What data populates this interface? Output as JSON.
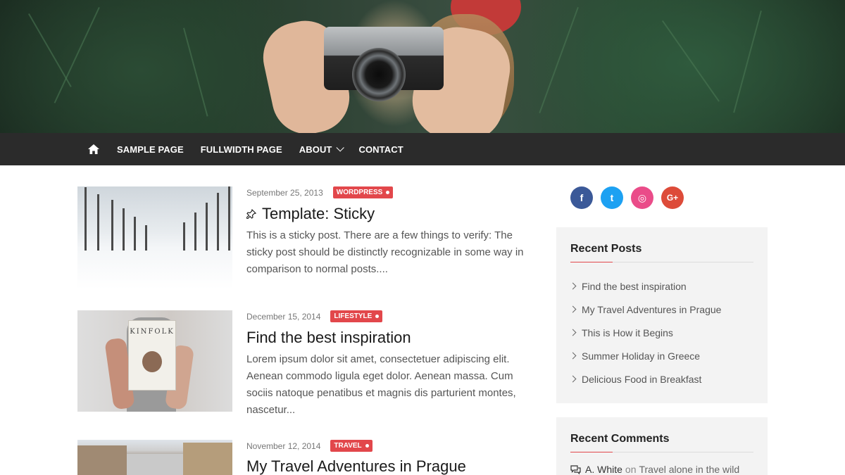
{
  "nav": {
    "items": [
      {
        "label": "SAMPLE PAGE"
      },
      {
        "label": "FULLWIDTH PAGE"
      },
      {
        "label": "ABOUT"
      },
      {
        "label": "CONTACT"
      }
    ]
  },
  "posts": [
    {
      "date": "September 25, 2013",
      "category": "WORDPRESS",
      "title": "Template: Sticky",
      "sticky": true,
      "excerpt": "This is a sticky post. There are a few things to verify: The sticky post should be distinctly recognizable in some way in comparison to normal posts...."
    },
    {
      "date": "December 15, 2014",
      "category": "LIFESTYLE",
      "title": "Find the best inspiration",
      "thumb_text": "KINFOLK",
      "excerpt": "Lorem ipsum dolor sit amet, consectetuer adipiscing elit. Aenean commodo ligula eget dolor. Aenean massa. Cum sociis natoque penatibus et magnis dis parturient montes, nascetur..."
    },
    {
      "date": "November 12, 2014",
      "category": "TRAVEL",
      "title": "My Travel Adventures in Prague"
    }
  ],
  "sidebar": {
    "social": [
      {
        "icon": "facebook-icon",
        "glyph": "f",
        "color": "#3b5998"
      },
      {
        "icon": "twitter-icon",
        "glyph": "t",
        "color": "#1da1f2"
      },
      {
        "icon": "dribbble-icon",
        "glyph": "◎",
        "color": "#ea4c89"
      },
      {
        "icon": "google-plus-icon",
        "glyph": "G+",
        "color": "#dd4b39"
      }
    ],
    "recent_posts": {
      "title": "Recent Posts",
      "items": [
        "Find the best inspiration",
        "My Travel Adventures in Prague",
        "This is How it Begins",
        "Summer Holiday in Greece",
        "Delicious Food in Breakfast"
      ]
    },
    "recent_comments": {
      "title": "Recent Comments",
      "author": "A. White",
      "on": "on",
      "post": "Travel alone in the wild"
    }
  },
  "colors": {
    "nav_bg": "#2b2b2b",
    "accent": "#e2474b",
    "widget_bg": "#f3f3f3"
  }
}
